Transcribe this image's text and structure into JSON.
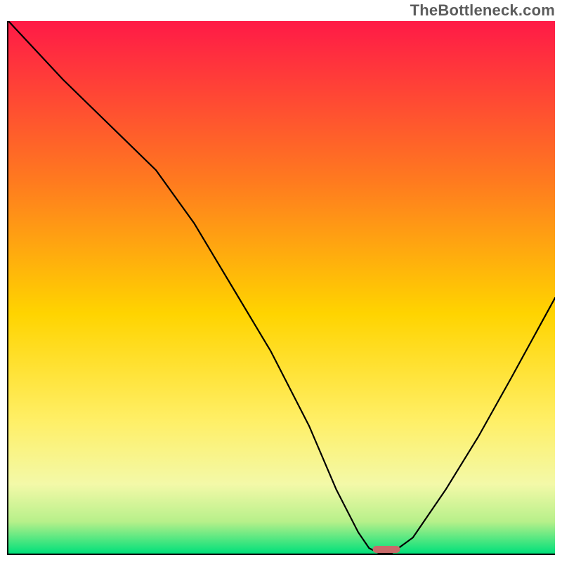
{
  "watermark": "TheBottleneck.com",
  "colors": {
    "grad_top": "#ff1a47",
    "grad_upper_mid": "#ff7a1f",
    "grad_mid": "#ffd400",
    "grad_lower_upper": "#ffef66",
    "grad_lower_mid": "#f3f9a8",
    "grad_near_bottom": "#b7f08a",
    "grad_bottom": "#00e07a",
    "curve": "#000000",
    "marker": "#c96a6a",
    "axis": "#000000"
  },
  "chart_data": {
    "type": "line",
    "title": "",
    "xlabel": "",
    "ylabel": "",
    "xlim": [
      0,
      100
    ],
    "ylim": [
      0,
      100
    ],
    "series": [
      {
        "name": "bottleneck-curve",
        "x": [
          0,
          10,
          20,
          27,
          34,
          41,
          48,
          55,
          60,
          64,
          66,
          68,
          70,
          74,
          80,
          86,
          92,
          100
        ],
        "values": [
          100,
          89,
          79,
          72,
          62,
          50,
          38,
          24,
          12,
          4,
          1,
          0,
          0,
          3,
          12,
          22,
          33,
          48
        ]
      }
    ],
    "marker": {
      "x": 69,
      "width_pct": 5
    },
    "grid": false,
    "legend": false
  }
}
